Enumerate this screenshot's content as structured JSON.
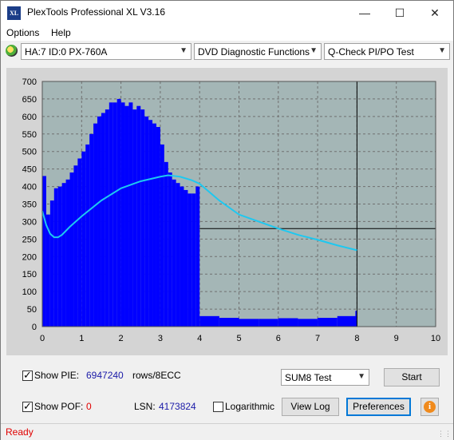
{
  "window": {
    "title": "PlexTools Professional XL V3.16",
    "icon_text": "XL",
    "minimize_symbol": "—",
    "maximize_symbol": "☐",
    "close_symbol": "✕"
  },
  "menu": {
    "items": [
      {
        "label": "Options"
      },
      {
        "label": "Help"
      }
    ]
  },
  "toolbar": {
    "drive": "HA:7 ID:0  PX-760A",
    "function": "DVD Diagnostic Functions",
    "test": "Q-Check PI/PO Test"
  },
  "chart_data": {
    "type": "bar",
    "x_range": [
      0,
      10
    ],
    "y_range": [
      0,
      700
    ],
    "x_ticks": [
      "0",
      "1",
      "2",
      "3",
      "4",
      "5",
      "6",
      "7",
      "8",
      "9",
      "10"
    ],
    "y_ticks": [
      "0",
      "50",
      "100",
      "150",
      "200",
      "250",
      "300",
      "350",
      "400",
      "450",
      "500",
      "550",
      "600",
      "650",
      "700"
    ],
    "grid": true,
    "colors": {
      "pie_bars": "#0000ff",
      "speed_line": "#1ec8f0",
      "plot_bg": "#a4b6b6",
      "frame": "#d4d4d4"
    },
    "series": [
      {
        "kind": "bars",
        "x": [
          0.0,
          0.1,
          0.2,
          0.3,
          0.4,
          0.5,
          0.6,
          0.7,
          0.8,
          0.9,
          1.0,
          1.1,
          1.2,
          1.3,
          1.4,
          1.5,
          1.6,
          1.7,
          1.8,
          1.9,
          2.0,
          2.1,
          2.2,
          2.3,
          2.4,
          2.5,
          2.6,
          2.7,
          2.8,
          2.9,
          3.0,
          3.1,
          3.2,
          3.3,
          3.4,
          3.5,
          3.6,
          3.7,
          3.8,
          3.9,
          4.0,
          4.5,
          5.0,
          5.5,
          6.0,
          6.5,
          7.0,
          7.5,
          8.0
        ],
        "y": [
          430,
          320,
          360,
          395,
          400,
          410,
          420,
          440,
          460,
          480,
          500,
          520,
          550,
          580,
          600,
          610,
          620,
          640,
          640,
          650,
          640,
          630,
          640,
          620,
          630,
          620,
          600,
          590,
          580,
          570,
          520,
          470,
          440,
          420,
          410,
          400,
          390,
          380,
          380,
          400,
          30,
          25,
          22,
          22,
          24,
          22,
          25,
          30,
          45
        ]
      },
      {
        "kind": "line",
        "x": [
          0.0,
          0.1,
          0.2,
          0.3,
          0.4,
          0.5,
          0.7,
          1.0,
          1.5,
          2.0,
          2.5,
          3.0,
          3.2,
          3.5,
          3.8,
          4.0,
          4.5,
          5.0,
          5.5,
          6.0,
          6.5,
          7.0,
          7.5,
          8.0
        ],
        "y": [
          330,
          290,
          265,
          255,
          255,
          262,
          285,
          315,
          360,
          395,
          415,
          428,
          432,
          428,
          418,
          408,
          360,
          320,
          300,
          280,
          262,
          248,
          232,
          218
        ]
      }
    ],
    "markers": {
      "vline_x": 8.0,
      "hline_y": 280
    }
  },
  "controls": {
    "show_pie_label": "Show PIE:",
    "pie_value": "6947240",
    "pie_unit": "rows/8ECC",
    "show_pof_label": "Show POF:",
    "pof_value": "0",
    "lsn_label": "LSN:",
    "lsn_value": "4173824",
    "logarithmic_label": "Logarithmic",
    "sum_test": "SUM8 Test",
    "start_label": "Start",
    "view_log_label": "View Log",
    "preferences_label": "Preferences",
    "info_symbol": "i"
  },
  "status": {
    "text": "Ready"
  }
}
